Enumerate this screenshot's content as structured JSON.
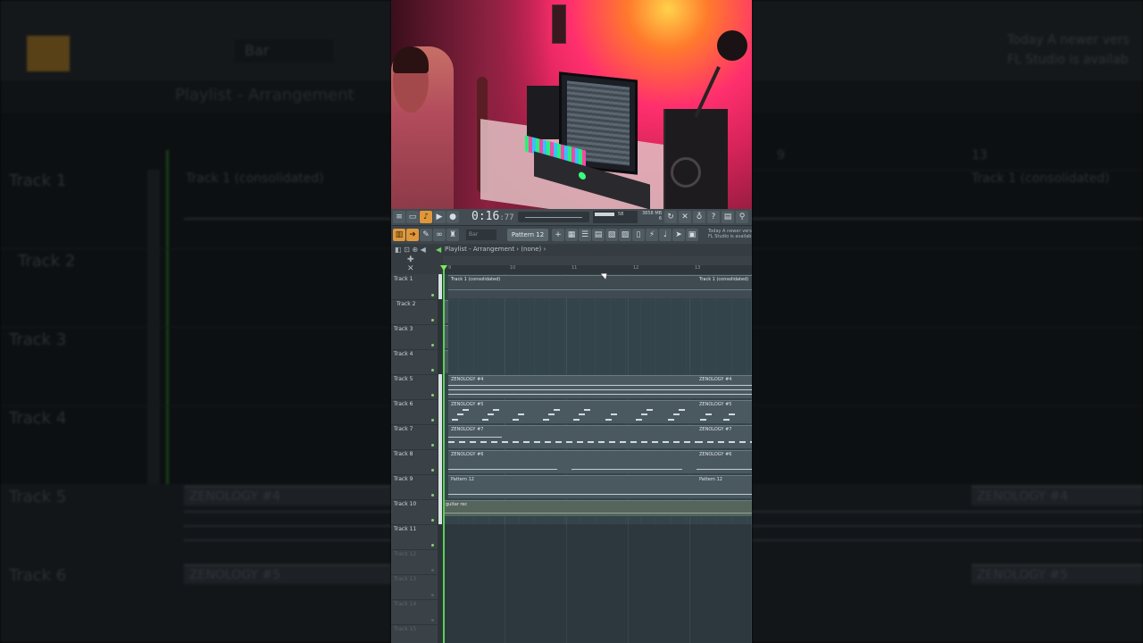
{
  "side_view": {
    "playlist_title": "Playlist - Arrangement",
    "snap": "Bar",
    "time": "0:16:77",
    "tracks": [
      "Track 1",
      "Track 2",
      "Track 3",
      "Track 4",
      "Track 5",
      "Track 6"
    ],
    "clip_track1": "Track 1 (consolidated)",
    "clip_track5": "ZENOLOGY #4",
    "clip_track6": "ZENOLOGY #5",
    "ruler_labels": [
      "9",
      "13"
    ],
    "hint_line1": "Today  A newer vers",
    "hint_line2": "FL Studio is availab"
  },
  "toolbar": {
    "time_main": "0:16",
    "time_frac": ":77",
    "memory_line1": "3858 MB",
    "memory_line2": "6",
    "cpu_value": "58",
    "pattern_label": "Pattern 12",
    "snap_label": "Bar",
    "hint_line1": "Today  A newer vers",
    "hint_line2": "FL Studio is availab"
  },
  "playlist": {
    "title": "Playlist - Arrangement",
    "breadcrumb": "(none)",
    "ruler": [
      "9",
      "10",
      "11",
      "12",
      "13"
    ]
  },
  "tracks": [
    {
      "name": "Track 1"
    },
    {
      "name": "Track 2"
    },
    {
      "name": "Track 3"
    },
    {
      "name": "Track 4"
    },
    {
      "name": "Track 5"
    },
    {
      "name": "Track 6"
    },
    {
      "name": "Track 7"
    },
    {
      "name": "Track 8"
    },
    {
      "name": "Track 9"
    },
    {
      "name": "Track 10"
    },
    {
      "name": "Track 11"
    },
    {
      "name": "Track 12"
    },
    {
      "name": "Track 13"
    },
    {
      "name": "Track 14"
    },
    {
      "name": "Track 15"
    }
  ],
  "clips": {
    "t1a": "Track 1 (consolidated)",
    "t1b": "Track 1 (consolidated)",
    "t5a": "ZENOLOGY #4",
    "t5b": "ZENOLOGY #4",
    "t6a": "ZENOLOGY #5",
    "t6b": "ZENOLOGY #5",
    "t7a": "ZENOLOGY #7",
    "t7b": "ZENOLOGY #7",
    "t8a": "ZENOLOGY #6",
    "t8b": "ZENOLOGY #6",
    "t9a": "Pattern 12",
    "t9b": "Pattern 12",
    "t10": "guitar rec"
  },
  "colors": {
    "accent_orange": "#e0973a",
    "playhead_green": "#59d352",
    "clip_grey": "#4a585f"
  }
}
